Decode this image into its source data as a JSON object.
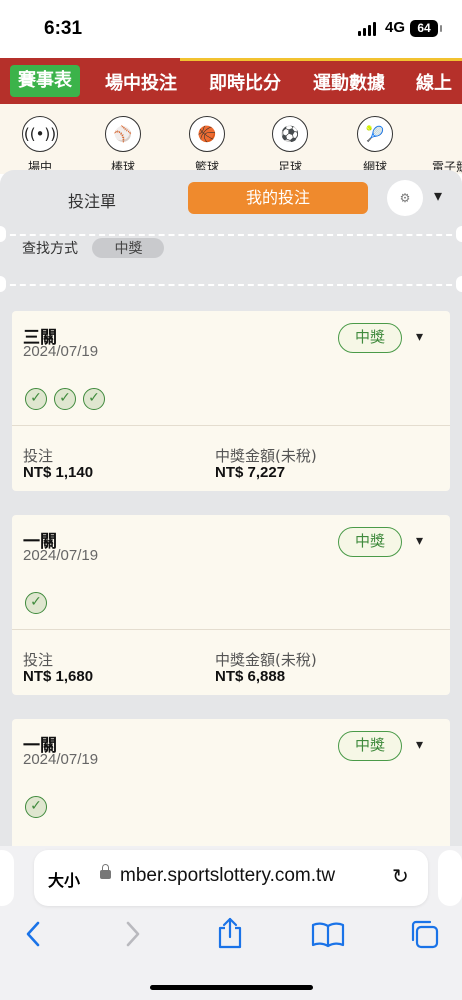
{
  "status": {
    "time": "6:31",
    "network": "4G",
    "battery": "64"
  },
  "topnav": {
    "items": [
      "賽事表",
      "場中投注",
      "即時比分",
      "運動數據",
      "線上"
    ]
  },
  "sports": {
    "items": [
      {
        "label": "場中",
        "icon": "live-broadcast-icon"
      },
      {
        "label": "棒球",
        "icon": "baseball-icon"
      },
      {
        "label": "籃球",
        "icon": "basketball-icon"
      },
      {
        "label": "足球",
        "icon": "soccer-icon"
      },
      {
        "label": "網球",
        "icon": "tennis-icon"
      },
      {
        "label": "電子競",
        "icon": "esports-icon"
      }
    ]
  },
  "sheet": {
    "tab_betslip": "投注單",
    "tab_mybets": "我的投注",
    "filter_label": "查找方式",
    "filter_value": "中獎"
  },
  "bets": [
    {
      "title": "三關",
      "date": "2024/07/19",
      "status": "中獎",
      "checks": 3,
      "stake_label": "投注",
      "stake": "NT$ 1,140",
      "win_label": "中獎金額(未稅)",
      "win": "NT$ 7,227"
    },
    {
      "title": "一關",
      "date": "2024/07/19",
      "status": "中獎",
      "checks": 1,
      "stake_label": "投注",
      "stake": "NT$ 1,680",
      "win_label": "中獎金額(未稅)",
      "win": "NT$ 6,888"
    },
    {
      "title": "一關",
      "date": "2024/07/19",
      "status": "中獎",
      "checks": 1
    }
  ],
  "browser": {
    "text_size": "大小",
    "url": "mber.sportslottery.com.tw"
  }
}
